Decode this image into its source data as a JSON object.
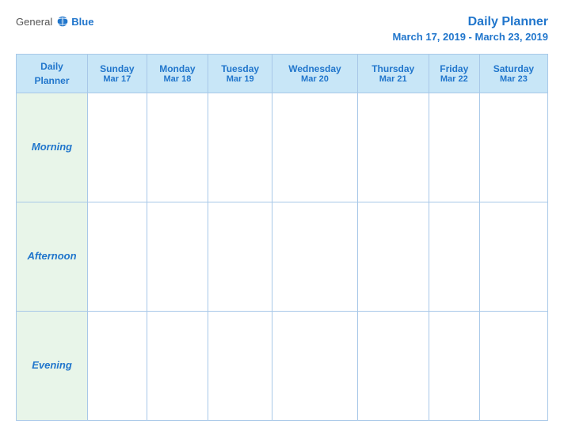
{
  "header": {
    "logo": {
      "general": "General",
      "blue": "Blue",
      "icon_alt": "globe-icon"
    },
    "title": "Daily Planner",
    "subtitle": "March 17, 2019 - March 23, 2019"
  },
  "table": {
    "label_header": "Daily\nPlanner",
    "days": [
      {
        "name": "Sunday",
        "date": "Mar 17"
      },
      {
        "name": "Monday",
        "date": "Mar 18"
      },
      {
        "name": "Tuesday",
        "date": "Mar 19"
      },
      {
        "name": "Wednesday",
        "date": "Mar 20"
      },
      {
        "name": "Thursday",
        "date": "Mar 21"
      },
      {
        "name": "Friday",
        "date": "Mar 22"
      },
      {
        "name": "Saturday",
        "date": "Mar 23"
      }
    ],
    "rows": [
      {
        "label": "Morning"
      },
      {
        "label": "Afternoon"
      },
      {
        "label": "Evening"
      }
    ]
  }
}
